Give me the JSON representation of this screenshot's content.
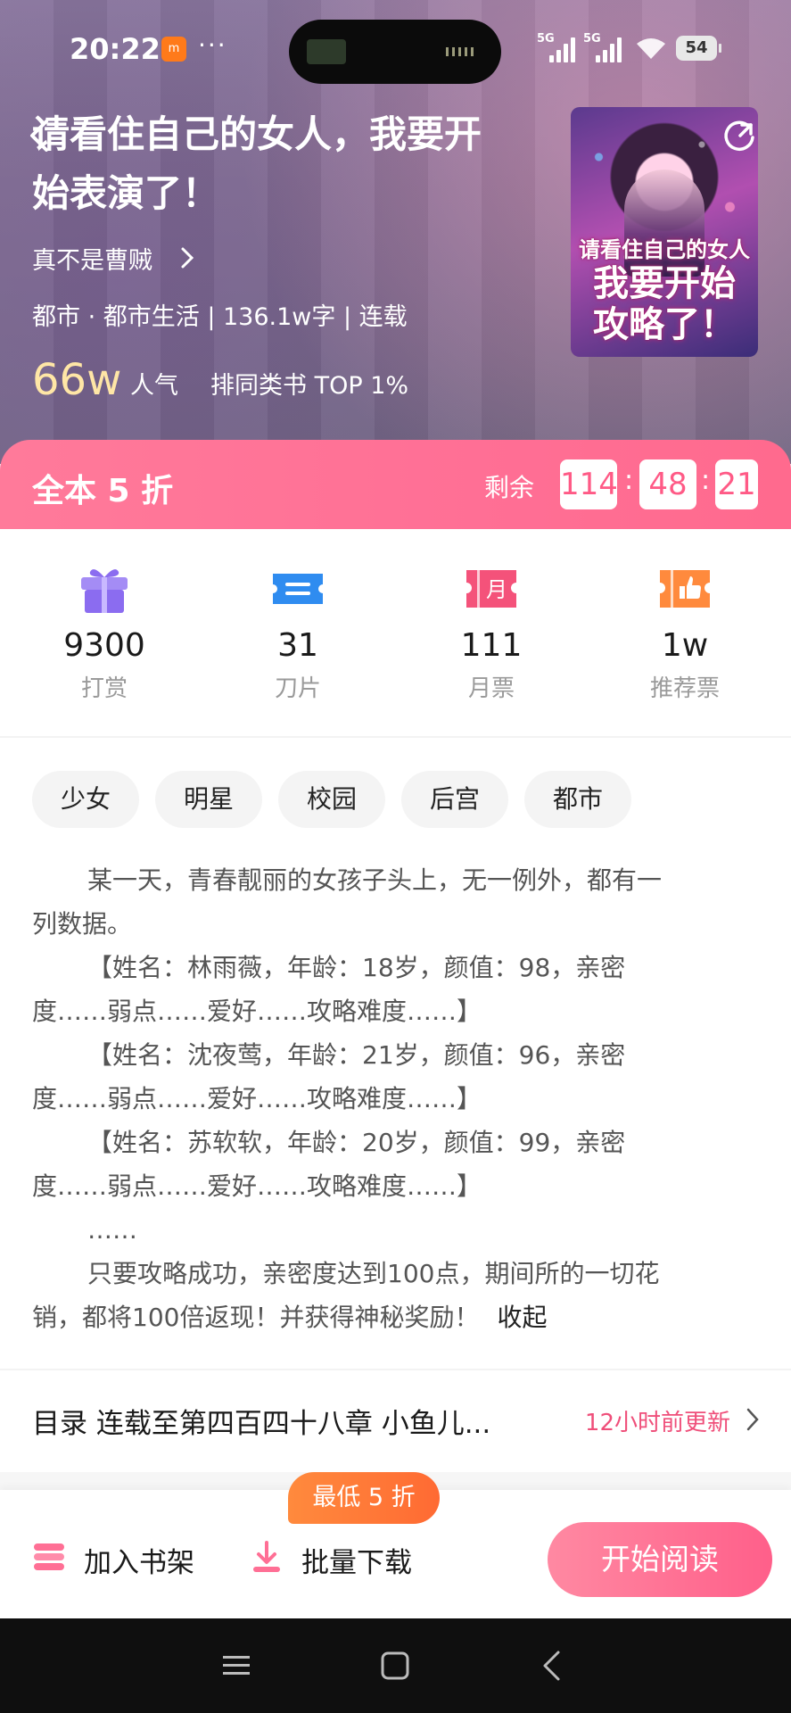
{
  "status_bar": {
    "time": "20:22",
    "app_badge": "m",
    "dots": "···",
    "sig1": "5G",
    "sig2": "5G",
    "battery": "54"
  },
  "book": {
    "title_line1": "请看住自己的女人，我要开",
    "title_line2": "始表演了！",
    "author": "真不是曹贼",
    "meta": "都市 · 都市生活 | 136.1w字 | 连载",
    "popularity_value": "66w",
    "popularity_label": "人气",
    "rank": "排同类书 TOP 1%",
    "cover_line1": "请看住自己的女人",
    "cover_line2": "我要开始",
    "cover_line3": "攻略了！"
  },
  "discount": {
    "label": "全本 5 折",
    "remain_label": "剩余",
    "hours": "114",
    "minutes": "48",
    "seconds": "21",
    "colon": ":"
  },
  "stats": [
    {
      "value": "9300",
      "label": "打赏",
      "icon": "gift-icon",
      "color": "#8b6cf0"
    },
    {
      "value": "31",
      "label": "刀片",
      "icon": "ticket-icon",
      "color": "#2f8cf0"
    },
    {
      "value": "111",
      "label": "月票",
      "icon": "monthly-ticket-icon",
      "color": "#f4527a",
      "glyph": "月"
    },
    {
      "value": "1w",
      "label": "推荐票",
      "icon": "thumbs-up-icon",
      "color": "#ff8a3d"
    }
  ],
  "tags": [
    "少女",
    "明星",
    "校园",
    "后宫",
    "都市"
  ],
  "synopsis": {
    "line1": "某一天，青春靓丽的女孩子头上，无一例外，都有一",
    "line2": "列数据。",
    "line3": "【姓名：林雨薇，年龄：18岁，颜值：98，亲密",
    "line4": "度……弱点……爱好……攻略难度……】",
    "line5": "【姓名：沈夜莺，年龄：21岁，颜值：96，亲密",
    "line6": "度……弱点……爱好……攻略难度……】",
    "line7": "【姓名：苏软软，年龄：20岁，颜值：99，亲密",
    "line8": "度……弱点……爱好……攻略难度……】",
    "line9": "……",
    "line10": "只要攻略成功，亲密度达到100点，期间所的一切花",
    "line11": "销，都将100倍返现！并获得神秘奖励！",
    "collapse": "收起"
  },
  "catalog": {
    "title": "目录 连载至第四百四十八章 小鱼儿...",
    "update": "12小时前更新"
  },
  "actions": {
    "shelf": "加入书架",
    "download": "批量下载",
    "promo": "最低 5 折",
    "read": "开始阅读"
  },
  "colors": {
    "accent": "#ff5f8a",
    "discount_bg": "#ff6f95",
    "gold": "#ffe6a6",
    "update_text": "#ef4f7a"
  }
}
